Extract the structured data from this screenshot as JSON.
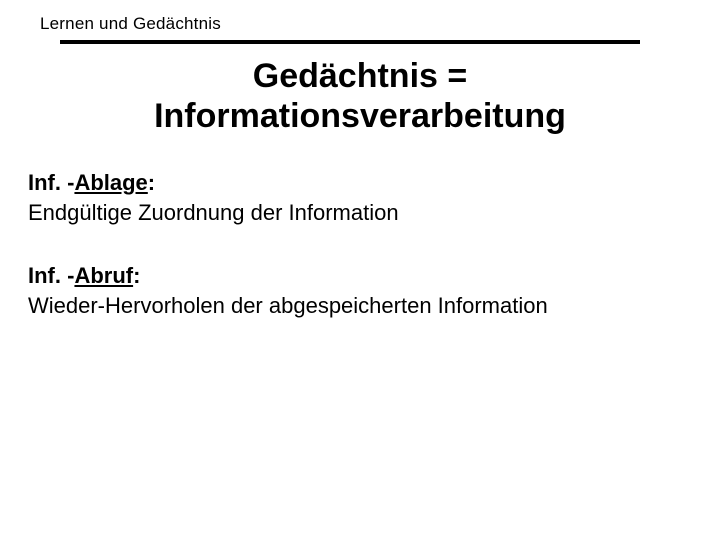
{
  "header": {
    "label": "Lernen und Gedächtnis"
  },
  "title": {
    "line1": "Gedächtnis =",
    "line2": "Informationsverarbeitung"
  },
  "sections": {
    "ablage": {
      "prefix": "Inf. -",
      "keyword": "Ablage",
      "suffix": ":",
      "body": "Endgültige Zuordnung der Information"
    },
    "abruf": {
      "prefix": "Inf. -",
      "keyword": "Abruf",
      "suffix": ":",
      "body": "Wieder-Hervorholen der abgespeicherten Information"
    }
  }
}
